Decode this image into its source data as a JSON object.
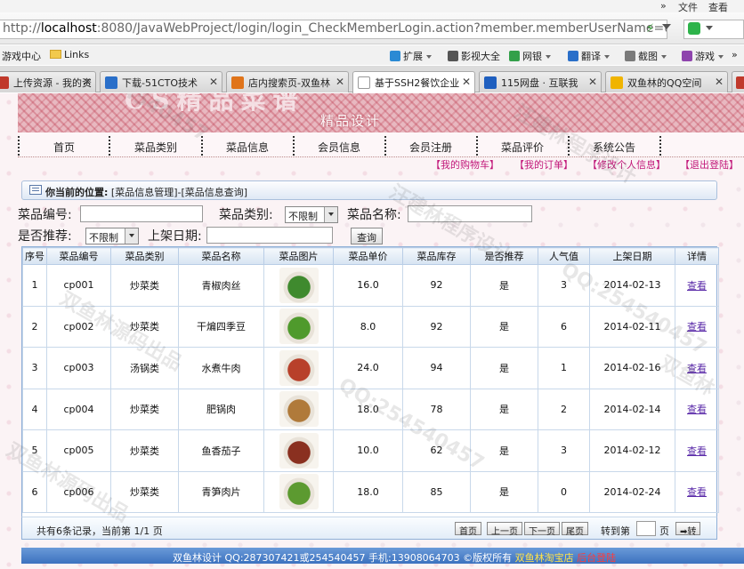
{
  "browser": {
    "menu": [
      "文件",
      "查看"
    ],
    "menu_more": "»",
    "address_host": "localhost",
    "address_rest": ":8080/JavaWebProject/login/login_CheckMemberLogin.action?member.memberUserName=u",
    "address_prefix": "http://",
    "bookmarks": [
      "游戏中心",
      "Links"
    ],
    "toolbar": [
      "扩展",
      "影视大全",
      "网银",
      "翻译",
      "截图",
      "游戏"
    ],
    "toolbar_more": "»",
    "tabs": [
      {
        "title": "上传资源 - 我的资",
        "color": "#c0392b"
      },
      {
        "title": "下载-51CTO技术",
        "color": "#2a6fc9"
      },
      {
        "title": "店内搜索页-双鱼林",
        "color": "#e0741a"
      },
      {
        "title": "基于SSH2餐饮企业",
        "color": "#ffffff"
      },
      {
        "title": "115网盘 · 互联我",
        "color": "#1f5fbf"
      },
      {
        "title": "双鱼林的QQ空间",
        "color": "#f0b400"
      }
    ],
    "active_tab": 3
  },
  "site": {
    "banner_title": "CS精品菜谱",
    "banner_sub": "精品设计",
    "nav": [
      "首页",
      "菜品类别",
      "菜品信息",
      "会员信息",
      "会员注册",
      "菜品评价",
      "系统公告"
    ],
    "user_menu": [
      "【我的购物车】",
      "【我的订单】",
      "【修改个人信息】",
      "【退出登陆】"
    ]
  },
  "breadcrumb": {
    "label": "你当前的位置:",
    "path": "[菜品信息管理]-[菜品信息查询]"
  },
  "filters": {
    "code_label": "菜品编号:",
    "category_label": "菜品类别:",
    "category_value": "不限制",
    "name_label": "菜品名称:",
    "recommend_label": "是否推荐:",
    "recommend_value": "不限制",
    "date_label": "上架日期:",
    "search_button": "查询"
  },
  "table": {
    "headers": [
      "序号",
      "菜品编号",
      "菜品类别",
      "菜品名称",
      "菜品图片",
      "菜品单价",
      "菜品库存",
      "是否推荐",
      "人气值",
      "上架日期",
      "详情"
    ],
    "rows": [
      {
        "no": "1",
        "code": "cp001",
        "category": "炒菜类",
        "name": "青椒肉丝",
        "price": "16.0",
        "stock": "92",
        "recommend": "是",
        "popularity": "3",
        "date": "2014-02-13",
        "detail": "查看",
        "img": "#3f8a2e"
      },
      {
        "no": "2",
        "code": "cp002",
        "category": "炒菜类",
        "name": "干煸四季豆",
        "price": "8.0",
        "stock": "92",
        "recommend": "是",
        "popularity": "6",
        "date": "2014-02-11",
        "detail": "查看",
        "img": "#4f9a2c"
      },
      {
        "no": "3",
        "code": "cp003",
        "category": "汤锅类",
        "name": "水煮牛肉",
        "price": "24.0",
        "stock": "94",
        "recommend": "是",
        "popularity": "1",
        "date": "2014-02-16",
        "detail": "查看",
        "img": "#b8402a"
      },
      {
        "no": "4",
        "code": "cp004",
        "category": "炒菜类",
        "name": "肥锅肉",
        "price": "18.0",
        "stock": "78",
        "recommend": "是",
        "popularity": "2",
        "date": "2014-02-14",
        "detail": "查看",
        "img": "#b07a3a"
      },
      {
        "no": "5",
        "code": "cp005",
        "category": "炒菜类",
        "name": "鱼香茄子",
        "price": "10.0",
        "stock": "62",
        "recommend": "是",
        "popularity": "3",
        "date": "2014-02-12",
        "detail": "查看",
        "img": "#8a3020"
      },
      {
        "no": "6",
        "code": "cp006",
        "category": "炒菜类",
        "name": "青笋肉片",
        "price": "18.0",
        "stock": "85",
        "recommend": "是",
        "popularity": "0",
        "date": "2014-02-24",
        "detail": "查看",
        "img": "#5c9a30"
      }
    ]
  },
  "pager": {
    "info": "共有6条记录，当前第 1/1 页",
    "first": "首页",
    "prev": "上一页",
    "next": "下一页",
    "last": "尾页",
    "goto_label": "转到第",
    "page_unit": "页",
    "go": "➡转"
  },
  "footer": {
    "text": "双鱼林设计 QQ:287307421或254540457 手机:13908064703 ©版权所有 ",
    "shop": "双鱼林淘宝店",
    "admin": "后台登陆"
  },
  "watermarks": [
    "QQ:254540457",
    "汪建林程序设计",
    "双鱼林源码出品",
    "QQ:254540457",
    "汪建林程序设计",
    "双鱼林源码出品",
    "QQ:254540457",
    "双鱼林"
  ]
}
